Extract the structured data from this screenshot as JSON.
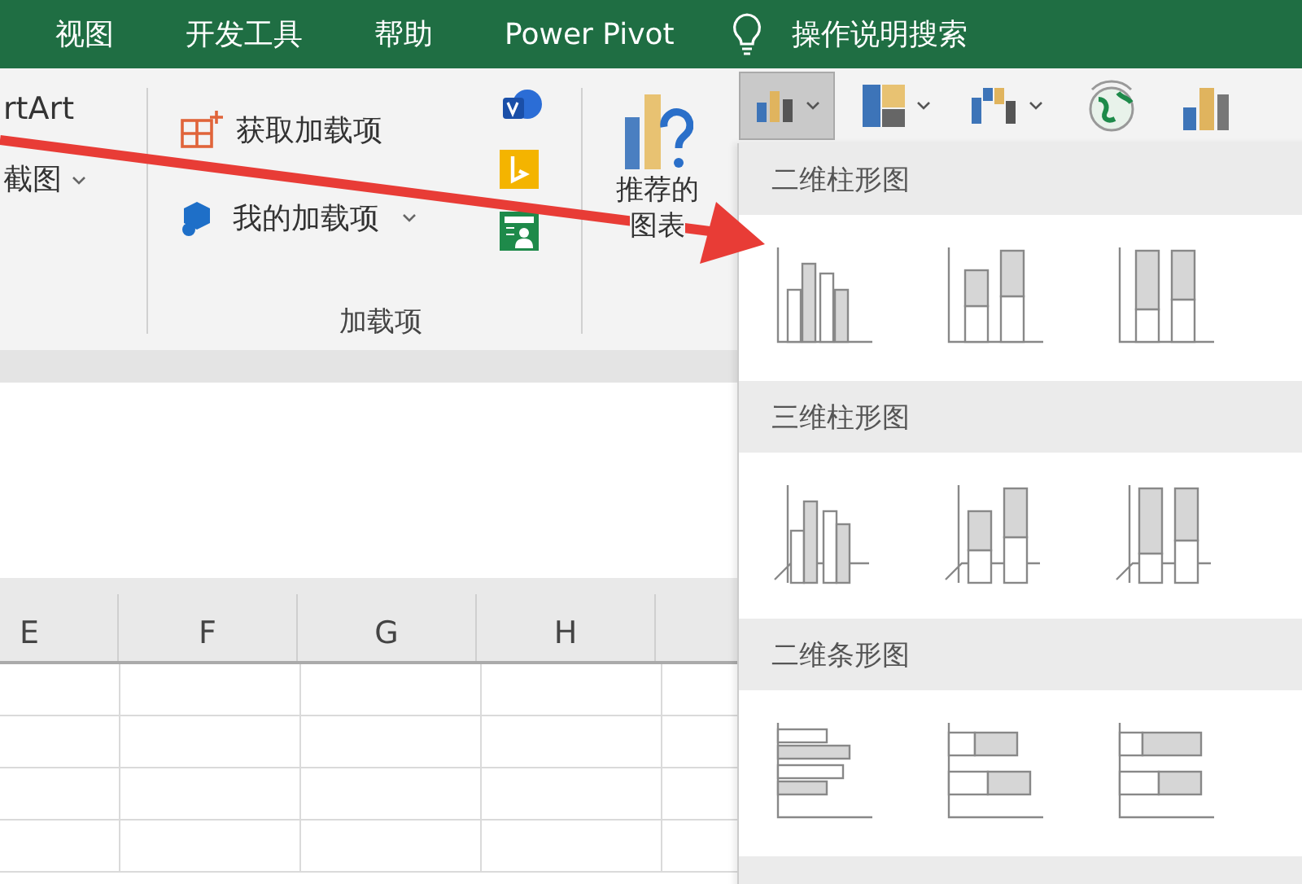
{
  "ribbon_tabs": [
    {
      "label": "视图"
    },
    {
      "label": "开发工具"
    },
    {
      "label": "帮助"
    },
    {
      "label": "Power Pivot"
    }
  ],
  "search": {
    "label": "操作说明搜索"
  },
  "ribbon": {
    "partial_items": [
      "rtArt",
      "截图"
    ],
    "addins_group": {
      "label": "加载项",
      "items": [
        {
          "label": "获取加载项",
          "kind": "get"
        },
        {
          "label": "我的加载项",
          "kind": "mine"
        }
      ]
    },
    "recommended_charts": {
      "label_lines": [
        "推荐的",
        "图表"
      ]
    },
    "chart_buttons": [
      {
        "kind": "column",
        "selected": true
      },
      {
        "kind": "hierarchy",
        "selected": false
      },
      {
        "kind": "waterfall",
        "selected": false
      },
      {
        "kind": "map",
        "selected": false
      },
      {
        "kind": "combo",
        "selected": false
      }
    ]
  },
  "columns": [
    "E",
    "F",
    "G",
    "H"
  ],
  "chart_menu": {
    "sections": [
      {
        "title": "二维柱形图",
        "kind": "column2d"
      },
      {
        "title": "三维柱形图",
        "kind": "column3d"
      },
      {
        "title": "二维条形图",
        "kind": "bar2d"
      }
    ]
  }
}
